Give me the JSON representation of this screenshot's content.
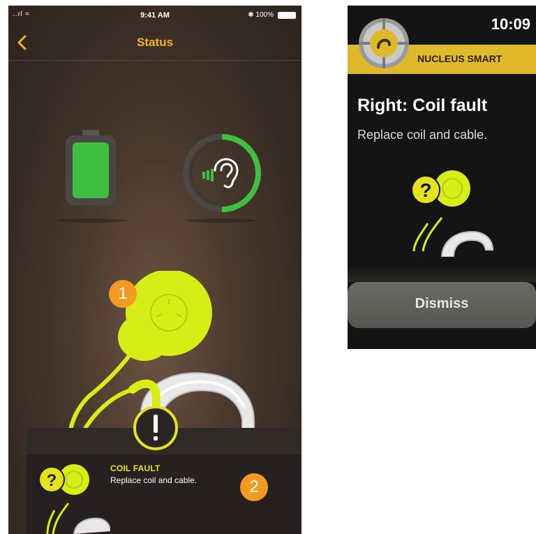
{
  "phone": {
    "status_bar": {
      "signal": "..ıl ≈",
      "time": "9:41 AM",
      "battery": "✱ 100%"
    },
    "nav": {
      "back_icon": "chevron-left-icon",
      "title": "Status"
    },
    "battery_color": "#3fbf3f",
    "device_color": "#d7ee16",
    "accent_color": "#f2b61e",
    "badges": [
      "1",
      "2"
    ],
    "fault": {
      "title": "COIL FAULT",
      "description": "Replace coil and cable."
    }
  },
  "watch": {
    "time": "10:09",
    "app_name": "NUCLEUS SMART",
    "title": "Right: Coil fault",
    "description": "Replace coil and cable.",
    "dismiss_label": "Dismiss",
    "banner_color": "#e0b92a"
  }
}
